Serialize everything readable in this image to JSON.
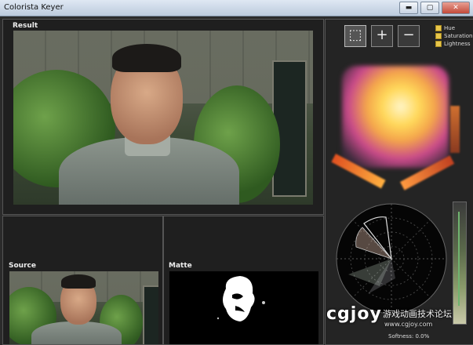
{
  "window": {
    "title": "Colorista Keyer",
    "minimize": "▬",
    "maximize": "▢",
    "close": "✕"
  },
  "panels": {
    "result_label": "Result",
    "source_label": "Source",
    "matte_label": "Matte"
  },
  "tools": [
    {
      "name": "select-tool",
      "glyph": "⬚"
    },
    {
      "name": "add-tool",
      "glyph": "+"
    },
    {
      "name": "subtract-tool",
      "glyph": "−"
    }
  ],
  "legend": [
    "Hue",
    "Saturation",
    "Lightness"
  ],
  "softness": {
    "label": "Softness:",
    "value": "0.0%"
  },
  "watermark": {
    "logo": "cgjoy",
    "tagline": "游戏动画技术论坛",
    "url": "www.cgjoy.com"
  },
  "colors": {
    "accent": "#e8c64a",
    "background": "#2b2b2b",
    "panel": "#1f1f1f"
  }
}
